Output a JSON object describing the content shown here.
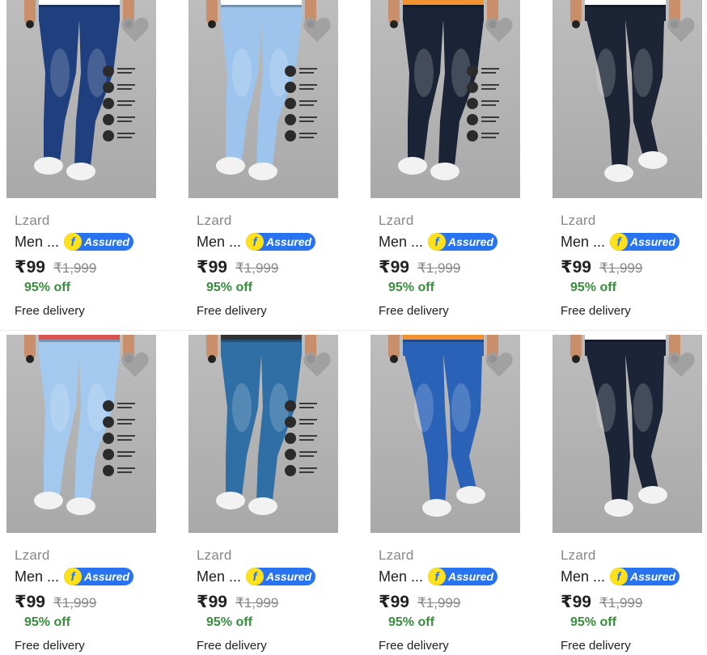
{
  "assured_badge_label": "Assured",
  "assured_badge_letter": "f",
  "colors": {
    "photo_background": "#b4b4b4",
    "assured_blue": "#2874f0",
    "assured_yellow": "#ffe11b",
    "discount_green": "#388e3c",
    "wishlist_heart": "#9e9e9e"
  },
  "products": [
    {
      "brand": "Lzard",
      "title": "Men ...",
      "price": "₹99",
      "mrp": "₹1,999",
      "discount": "95% off",
      "delivery": "Free delivery",
      "jeans_color": "#1f3f7e",
      "shirt_color": "#ffffff",
      "feature_icons": true,
      "leg_pose": "straight"
    },
    {
      "brand": "Lzard",
      "title": "Men ...",
      "price": "₹99",
      "mrp": "₹1,999",
      "discount": "95% off",
      "delivery": "Free delivery",
      "jeans_color": "#9cc4ec",
      "shirt_color": "#ffffff",
      "feature_icons": true,
      "leg_pose": "straight"
    },
    {
      "brand": "Lzard",
      "title": "Men ...",
      "price": "₹99",
      "mrp": "₹1,999",
      "discount": "95% off",
      "delivery": "Free delivery",
      "jeans_color": "#1b2436",
      "shirt_color": "#f29330",
      "feature_icons": true,
      "leg_pose": "straight"
    },
    {
      "brand": "Lzard",
      "title": "Men ...",
      "price": "₹99",
      "mrp": "₹1,999",
      "discount": "95% off",
      "delivery": "Free delivery",
      "jeans_color": "#1c2435",
      "shirt_color": "#ffffff",
      "feature_icons": false,
      "leg_pose": "crossed"
    },
    {
      "brand": "Lzard",
      "title": "Men ...",
      "price": "₹99",
      "mrp": "₹1,999",
      "discount": "95% off",
      "delivery": "Free delivery",
      "jeans_color": "#a3c9ef",
      "shirt_color": "#d9534f",
      "feature_icons": true,
      "leg_pose": "straight"
    },
    {
      "brand": "Lzard",
      "title": "Men ...",
      "price": "₹99",
      "mrp": "₹1,999",
      "discount": "95% off",
      "delivery": "Free delivery",
      "jeans_color": "#2f6fa6",
      "shirt_color": "#333333",
      "feature_icons": true,
      "leg_pose": "straight"
    },
    {
      "brand": "Lzard",
      "title": "Men ...",
      "price": "₹99",
      "mrp": "₹1,999",
      "discount": "95% off",
      "delivery": "Free delivery",
      "jeans_color": "#2a62b8",
      "shirt_color": "#f29330",
      "feature_icons": false,
      "leg_pose": "crossed"
    },
    {
      "brand": "Lzard",
      "title": "Men ...",
      "price": "₹99",
      "mrp": "₹1,999",
      "discount": "95% off",
      "delivery": "Free delivery",
      "jeans_color": "#1c2538",
      "shirt_color": "#ffffff",
      "feature_icons": false,
      "leg_pose": "crossed"
    }
  ]
}
